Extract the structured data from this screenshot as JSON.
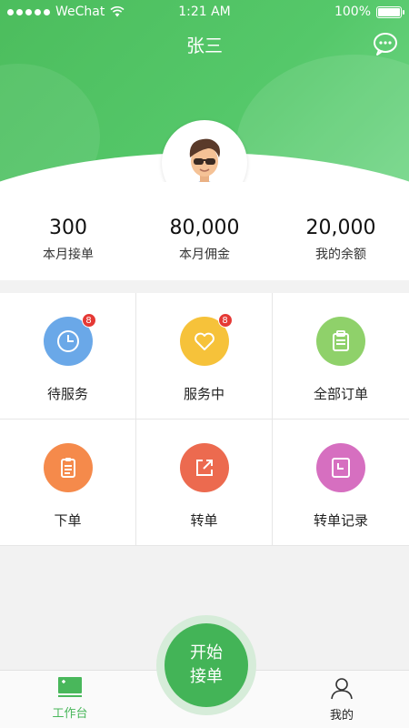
{
  "status_bar": {
    "carrier": "WeChat",
    "time": "1:21 AM",
    "battery": "100%"
  },
  "header": {
    "title": "张三",
    "chat_icon": "chat-bubble-icon",
    "avatar_icon": "user-avatar"
  },
  "stats": [
    {
      "value": "300",
      "label": "本月接单"
    },
    {
      "value": "80,000",
      "label": "本月佣金"
    },
    {
      "value": "20,000",
      "label": "我的余额"
    }
  ],
  "grid": [
    {
      "label": "待服务",
      "icon": "clock-icon",
      "color": "#6aa8e8",
      "badge": "8"
    },
    {
      "label": "服务中",
      "icon": "heart-icon",
      "color": "#f6c23a",
      "badge": "8"
    },
    {
      "label": "全部订单",
      "icon": "clipboard-icon",
      "color": "#8fd16a"
    },
    {
      "label": "下单",
      "icon": "order-form-icon",
      "color": "#f58a4b"
    },
    {
      "label": "转单",
      "icon": "share-out-icon",
      "color": "#ec6a4f"
    },
    {
      "label": "转单记录",
      "icon": "clock-square-icon",
      "color": "#d66fc0"
    }
  ],
  "tabbar": {
    "left_label": "工作台",
    "right_label": "我的",
    "start_line1": "开始",
    "start_line2": "接单",
    "active_color": "#49b75b"
  }
}
